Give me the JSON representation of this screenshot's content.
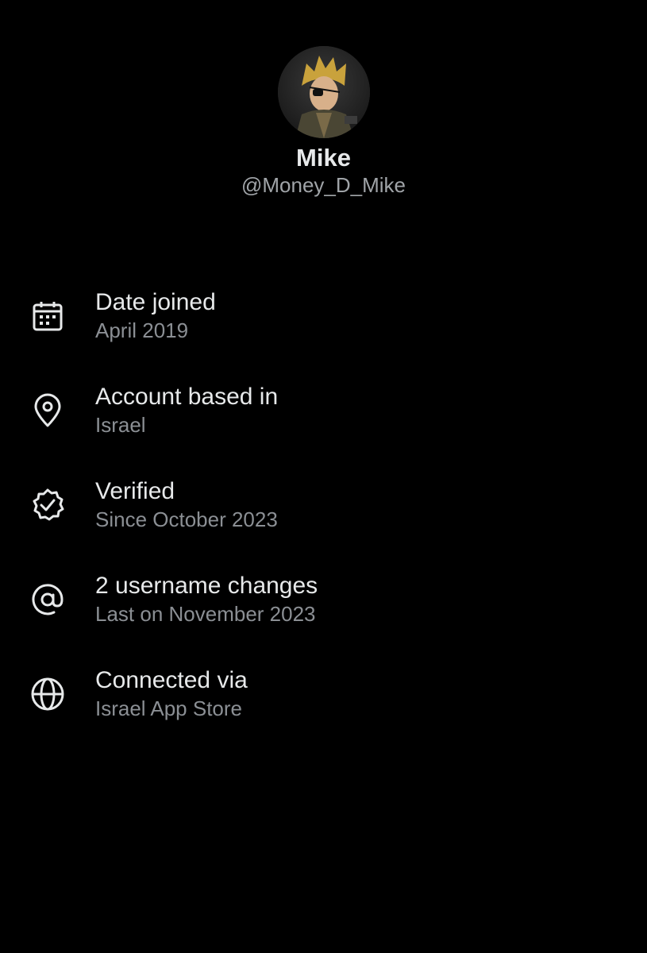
{
  "profile": {
    "display_name": "Mike",
    "handle": "@Money_D_Mike"
  },
  "details": [
    {
      "icon": "calendar-icon",
      "label": "Date joined",
      "value": "April 2019"
    },
    {
      "icon": "location-pin-icon",
      "label": "Account based in",
      "value": "Israel"
    },
    {
      "icon": "verified-badge-icon",
      "label": "Verified",
      "value": "Since October 2023"
    },
    {
      "icon": "at-sign-icon",
      "label": "2 username changes",
      "value": "Last on November 2023"
    },
    {
      "icon": "globe-icon",
      "label": "Connected via",
      "value": "Israel App Store"
    }
  ],
  "colors": {
    "background": "#000000",
    "primary_text": "#e7e9ea",
    "secondary_text": "#8b8f94"
  }
}
